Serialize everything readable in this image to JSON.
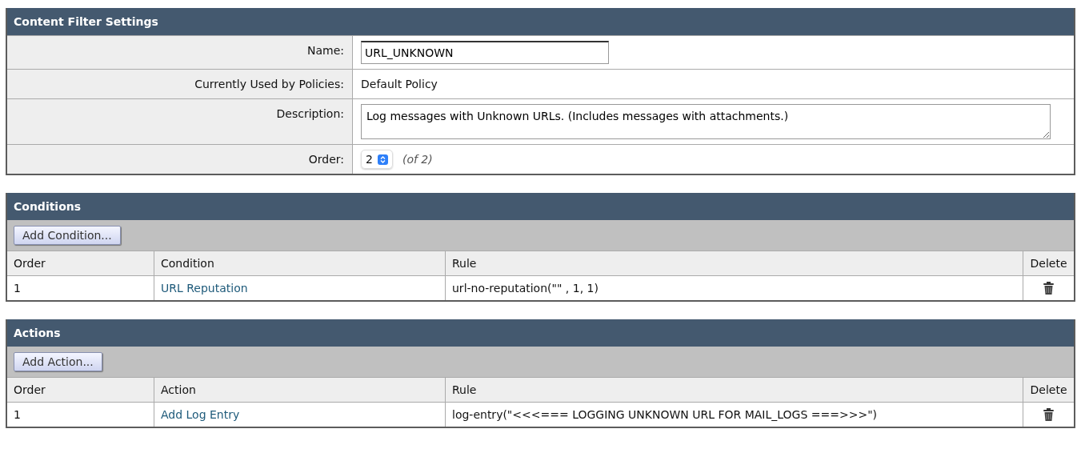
{
  "settings": {
    "title": "Content Filter Settings",
    "name": {
      "label": "Name:",
      "value": "URL_UNKNOWN"
    },
    "used_by": {
      "label": "Currently Used by Policies:",
      "value": "Default Policy"
    },
    "description": {
      "label": "Description:",
      "value": "Log messages with Unknown URLs. (Includes messages with attachments.)"
    },
    "order": {
      "label": "Order:",
      "value": "2",
      "of": "(of 2)"
    }
  },
  "sections": [
    {
      "title": "Conditions",
      "button": "Add Condition...",
      "columns": [
        "Order",
        "Condition",
        "Rule",
        "Delete"
      ],
      "rows": [
        {
          "order": "1",
          "name": "URL Reputation",
          "rule": "url-no-reputation(\"\" , 1, 1)"
        }
      ]
    },
    {
      "title": "Actions",
      "button": "Add Action...",
      "columns": [
        "Order",
        "Action",
        "Rule",
        "Delete"
      ],
      "rows": [
        {
          "order": "1",
          "name": "Add Log Entry",
          "rule": "log-entry(\"<<<=== LOGGING UNKNOWN URL FOR MAIL_LOGS ===>>>\")"
        }
      ]
    }
  ]
}
